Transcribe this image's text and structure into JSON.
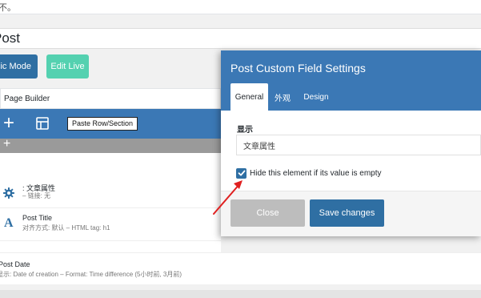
{
  "top_notice": {
    "text": "不。"
  },
  "post_title": {
    "value": "Post"
  },
  "mode_buttons": {
    "basic_label": "Basic Mode",
    "live_label": "Edit Live"
  },
  "page_builder": {
    "title": "Page Builder",
    "tooltip": "Paste Row/Section",
    "modules": [
      {
        "icon": "gear-icon",
        "title": ": 文章属性",
        "subtitle": "– 链接: 无"
      },
      {
        "icon": "letter-a-icon",
        "title": "Post Title",
        "subtitle": "对齐方式: 默认   – HTML tag: h1"
      }
    ],
    "post_date": {
      "title": "Post Date",
      "subtitle": "显示: Date of creation   – Format: Time difference (5小时前, 3月前)"
    }
  },
  "dialog": {
    "title": "Post Custom Field Settings",
    "tabs": [
      {
        "label": "General",
        "active": true
      },
      {
        "label": "外观",
        "active": false
      },
      {
        "label": "Design",
        "active": false
      }
    ],
    "field_label": "显示",
    "field_value": "文章属性",
    "checkbox_label": "Hide this element if its value is empty",
    "checkbox_checked": true,
    "close_label": "Close",
    "save_label": "Save changes"
  },
  "colors": {
    "accent_blue": "#3b78b5",
    "button_blue": "#2f6fa3",
    "live_green": "#54d1b0",
    "annotation_red": "#e02020"
  }
}
